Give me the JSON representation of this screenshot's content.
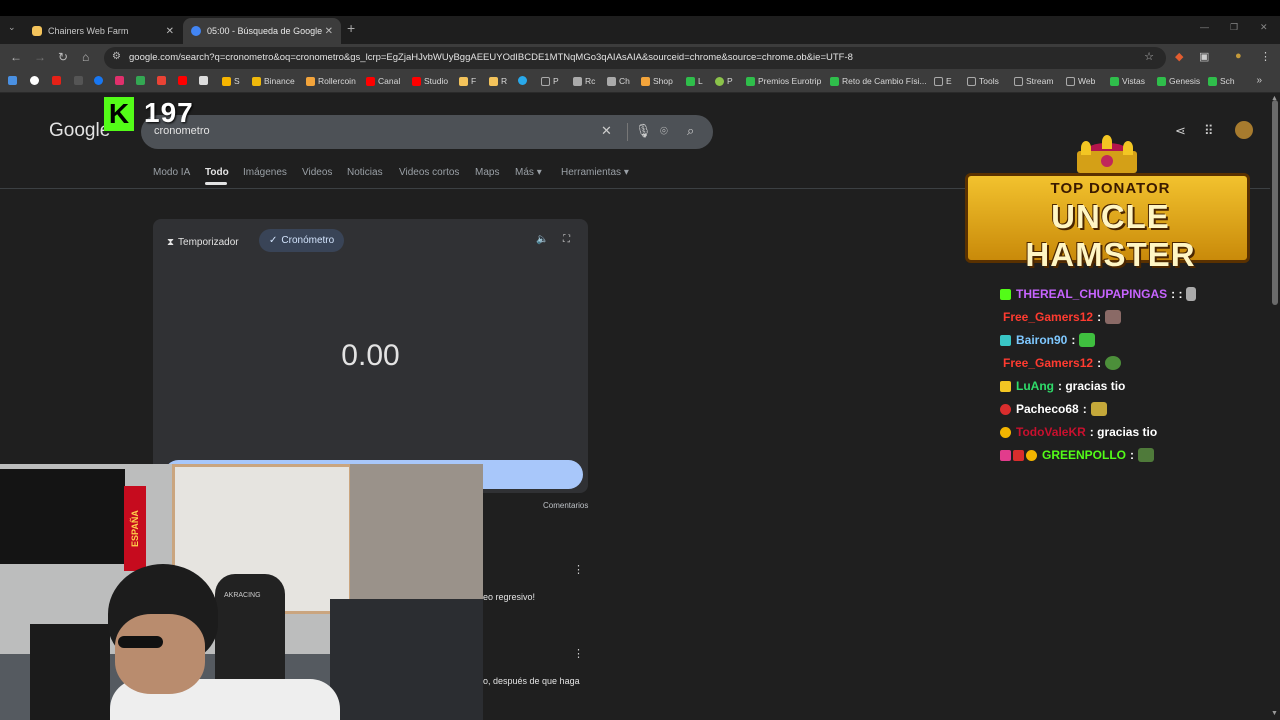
{
  "tabs": [
    {
      "title": "Chainers Web Farm",
      "favicon_color": "#f3c35b"
    },
    {
      "title": "05:00 - Búsqueda de Google",
      "favicon_color": "#4285f4"
    }
  ],
  "toolbar": {
    "url": "google.com/search?q=cronometro&oq=cronometro&gs_lcrp=EgZjaHJvbWUyBggAEEUYOdIBCDE1MTNqMGo3qAIAsAIA&sourceid=chrome&source=chrome.ob&ie=UTF-8"
  },
  "bookmarks": [
    {
      "label": "S",
      "color": "#f7b500"
    },
    {
      "label": "Binance",
      "color": "#f0b90b"
    },
    {
      "label": "Rollercoin",
      "color": "#f3a43b"
    },
    {
      "label": "Canal",
      "color": "#ff0000"
    },
    {
      "label": "Studio",
      "color": "#ff0000"
    },
    {
      "label": "F",
      "color": "#f3c35b"
    },
    {
      "label": "R",
      "color": "#f3c35b"
    },
    {
      "label": "P",
      "color": "#aaaaaa"
    },
    {
      "label": "Rc",
      "color": "#aaaaaa"
    },
    {
      "label": "Ch",
      "color": "#aaaaaa"
    },
    {
      "label": "Shop",
      "color": "#f3a43b"
    },
    {
      "label": "L",
      "color": "#2fbe4b"
    },
    {
      "label": "P",
      "color": "#8bc34a"
    },
    {
      "label": "Premios Eurotrip",
      "color": "#2fbe4b"
    },
    {
      "label": "Reto de Cambio Físi...",
      "color": "#2fbe4b"
    },
    {
      "label": "E",
      "color": "#aaaaaa"
    },
    {
      "label": "Tools",
      "color": "#aaaaaa"
    },
    {
      "label": "Stream",
      "color": "#aaaaaa"
    },
    {
      "label": "Web",
      "color": "#aaaaaa"
    },
    {
      "label": "Vistas",
      "color": "#2fbe4b"
    },
    {
      "label": "Genesis",
      "color": "#2fbe4b"
    },
    {
      "label": "Sch",
      "color": "#2fbe4b"
    }
  ],
  "overlay": {
    "kick_letter": "K",
    "viewer_count": "197"
  },
  "search": {
    "logo": "Google",
    "query": "cronometro"
  },
  "nav_tabs": [
    "Modo IA",
    "Todo",
    "Imágenes",
    "Videos",
    "Noticias",
    "Videos cortos",
    "Maps",
    "Más",
    "Herramientas"
  ],
  "widget": {
    "tab_timer": "Temporizador",
    "tab_stopwatch": "Cronómetro",
    "time": "0.00",
    "feedback": "Comentarios"
  },
  "results": {
    "snippet1": "eo regresivo!",
    "snippet2": "o, después de que haga"
  },
  "webcam": {
    "flag_text": "ESPAÑA",
    "chair_brand": "AKRACING"
  },
  "donator": {
    "header": "TOP DONATOR",
    "name": "UNCLE HAMSTER"
  },
  "chat": [
    {
      "user": "THEREAL_CHUPAPINGAS",
      "user_color": "#c764ff",
      "badges": [
        "#53fc18"
      ],
      "message": ": :",
      "emote_color": "#aaaaaa"
    },
    {
      "user": "Free_Gamers12",
      "user_color": "#ff3b30",
      "badges": [],
      "message": ":",
      "emote_color": "#8a6a66"
    },
    {
      "user": "Bairon90",
      "user_color": "#7fc8ff",
      "badges": [
        "#39c6c6"
      ],
      "message": ":",
      "emote_color": "#3fbf3f"
    },
    {
      "user": "Free_Gamers12",
      "user_color": "#ff3b30",
      "badges": [],
      "message": ":",
      "emote_color": "#4c8f3a"
    },
    {
      "user": "LuAng",
      "user_color": "#2fdc6a",
      "badges": [
        "#f3c623"
      ],
      "message": ": gracias tio",
      "emote_color": ""
    },
    {
      "user": "Pacheco68",
      "user_color": "#ffffff",
      "badges": [
        "#d92d2d"
      ],
      "message": ":",
      "emote_color": "#c4a83a"
    },
    {
      "user": "TodoValeKR",
      "user_color": "#c8102e",
      "badges": [
        "#f3b500"
      ],
      "message": ": gracias tio",
      "emote_color": ""
    },
    {
      "user": "GREENPOLLO",
      "user_color": "#53fc18",
      "badges": [
        "#e23c8c",
        "#d92d2d",
        "#f3b500"
      ],
      "message": ":",
      "emote_color": "#4f7a3a"
    }
  ]
}
